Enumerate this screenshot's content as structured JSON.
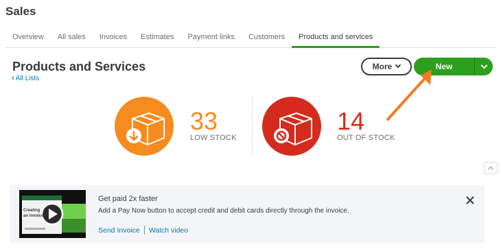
{
  "app": {
    "title": "Sales"
  },
  "tabs": [
    {
      "label": "Overview"
    },
    {
      "label": "All sales"
    },
    {
      "label": "Invoices"
    },
    {
      "label": "Estimates"
    },
    {
      "label": "Payment links"
    },
    {
      "label": "Customers"
    },
    {
      "label": "Products and services",
      "active": true
    }
  ],
  "header": {
    "title": "Products and Services",
    "back_link": "All Lists",
    "more_label": "More",
    "new_label": "New"
  },
  "stats": {
    "low_stock": {
      "value": "33",
      "label": "LOW STOCK",
      "color": "#f68b1f",
      "icon": "box-download-icon"
    },
    "out_of_stock": {
      "value": "14",
      "label": "OUT OF STOCK",
      "color": "#d52b1e",
      "icon": "box-blocked-icon"
    }
  },
  "banner": {
    "title": "Get paid 2x faster",
    "description": "Add a Pay Now button to accept credit and debit cards directly through the invoice.",
    "send_invoice_label": "Send Invoice",
    "watch_video_label": "Watch video",
    "thumb_text": "Creating an invoice"
  },
  "colors": {
    "accent_green": "#2ca01c",
    "link_blue": "#0077c5",
    "annotation_orange": "#f47c20"
  }
}
